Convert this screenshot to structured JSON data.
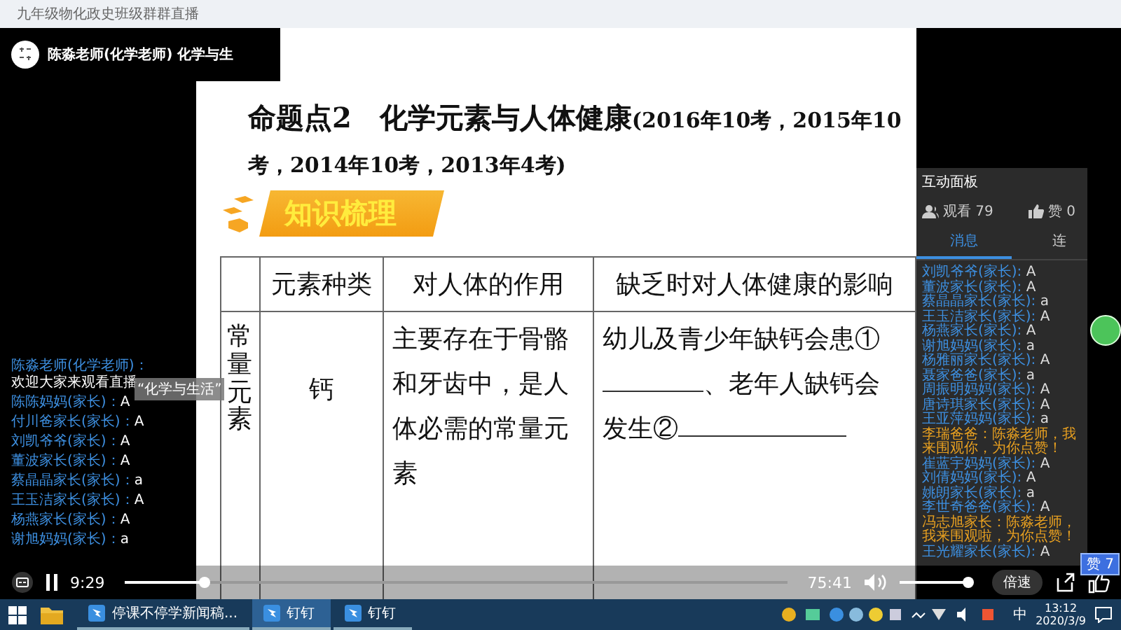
{
  "window": {
    "title": "九年级物化政史班级群群直播"
  },
  "streamer": {
    "name": "陈淼老师(化学老师) 化学与生"
  },
  "slide": {
    "title": "命题点2　化学元素与人体健康",
    "title_note": "(2016年10考，2015年10考，2014年10考，2013年4考)",
    "banner": "知识梳理",
    "table": {
      "columns": [
        "元素种类",
        "对人体的作用",
        "缺乏时对人体健康的影响"
      ],
      "rows": [
        {
          "group": "常量元素",
          "element": "钙",
          "role": "主要存在于骨骼和牙齿中，是人体必需的常量元素",
          "effect": [
            {
              "kind": "text",
              "text": "幼儿及青少年缺钙会患①"
            },
            {
              "kind": "blank"
            },
            {
              "kind": "text",
              "text": "、老年人缺钙会"
            },
            {
              "kind": "text",
              "text": "发生②"
            },
            {
              "kind": "blank"
            }
          ]
        }
      ]
    }
  },
  "toast": "“化学与生活”",
  "overlay_chat": [
    {
      "author": "陈淼老师(化学老师)：",
      "text": "欢迎大家来观看直播"
    },
    {
      "author": "陈陈妈妈(家长)：",
      "text": "A"
    },
    {
      "author": "付川爸家长(家长)：",
      "text": "A"
    },
    {
      "author": "刘凯爷爷(家长)：",
      "text": "A"
    },
    {
      "author": "董波家长(家长)：",
      "text": "A"
    },
    {
      "author": "蔡晶晶家长(家长)：",
      "text": "a"
    },
    {
      "author": "王玉洁家长(家长)：",
      "text": "A"
    },
    {
      "author": "杨燕家长(家长)：",
      "text": "A"
    },
    {
      "author": "谢旭妈妈(家长)：",
      "text": "a"
    }
  ],
  "panel": {
    "title": "互动面板",
    "viewers": "观看 79",
    "likes": "赞 0",
    "tabs": [
      {
        "label": "消息",
        "selected": true
      },
      {
        "label": "连",
        "selected": false
      }
    ],
    "messages": [
      {
        "kind": "chat",
        "author": "刘凯爷爷(家长):",
        "text": "A"
      },
      {
        "kind": "chat",
        "author": "董波家长(家长):",
        "text": "A"
      },
      {
        "kind": "chat",
        "author": "蔡晶晶家长(家长):",
        "text": "a"
      },
      {
        "kind": "chat",
        "author": "王玉洁家长(家长):",
        "text": "A"
      },
      {
        "kind": "chat",
        "author": "杨燕家长(家长):",
        "text": "A"
      },
      {
        "kind": "chat",
        "author": "谢旭妈妈(家长):",
        "text": "a"
      },
      {
        "kind": "chat",
        "author": "杨雅丽家长(家长):",
        "text": "A"
      },
      {
        "kind": "chat",
        "author": "聂家爸爸(家长):",
        "text": "a"
      },
      {
        "kind": "chat",
        "author": "周振明妈妈(家长):",
        "text": "A"
      },
      {
        "kind": "chat",
        "author": "唐诗琪家长(家长):",
        "text": "A"
      },
      {
        "kind": "chat",
        "author": "王亚萍妈妈(家长):",
        "text": "a"
      },
      {
        "kind": "notice",
        "text": "李瑞爸爸：陈淼老师，我来围观你，为你点赞！"
      },
      {
        "kind": "chat",
        "author": "崔蓝宇妈妈(家长):",
        "text": "A"
      },
      {
        "kind": "chat",
        "author": "刘倩妈妈(家长):",
        "text": "A"
      },
      {
        "kind": "chat",
        "author": "姚朗家长(家长):",
        "text": "a"
      },
      {
        "kind": "chat",
        "author": "李世奇爸爸(家长):",
        "text": "A"
      },
      {
        "kind": "notice",
        "text": "冯志旭家长：陈淼老师，我来围观啦，为你点赞！"
      },
      {
        "kind": "chat",
        "author": "王光耀家长(家长):",
        "text": "A"
      }
    ]
  },
  "player": {
    "elapsed": "9:29",
    "progress": {
      "level": 0.12
    },
    "duration": "75:41",
    "volume": {
      "level": 0.95
    },
    "speed_button": "倍速",
    "like_badge": "赞 7"
  },
  "taskbar": {
    "items": [
      {
        "label": "停课不停学新闻稿...",
        "selected": false
      },
      {
        "label": "钉钉",
        "selected": true
      },
      {
        "label": "钉钉",
        "selected": false
      }
    ],
    "ime": "中",
    "time": "13:12",
    "date": "2020/3/9"
  }
}
